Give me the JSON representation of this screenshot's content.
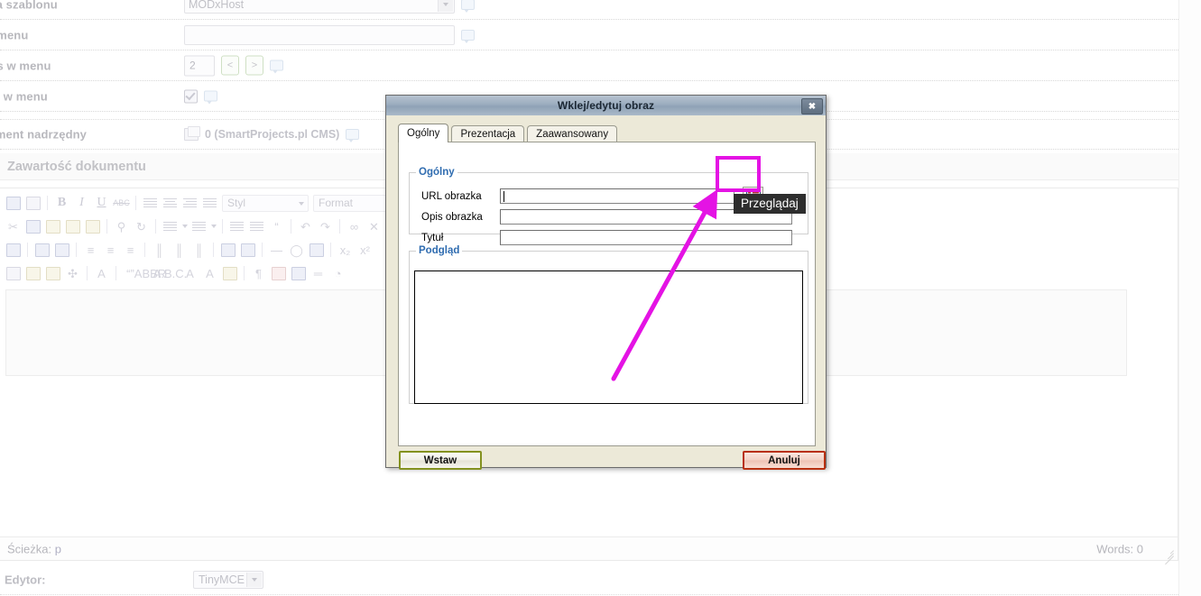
{
  "backend_form": {
    "rows": [
      {
        "label": "Używa szablonu",
        "type": "select",
        "value": "MODxHost",
        "has_help": true
      },
      {
        "label": "Tytuł menu",
        "type": "text",
        "value": "",
        "has_help": true
      },
      {
        "label": "Indeks w menu",
        "type": "number",
        "value": "2",
        "prev_label": "<",
        "next_label": ">",
        "has_help": true
      },
      {
        "label": "Pokaż w menu",
        "type": "checkbox",
        "checked": true,
        "has_help": true
      },
      {
        "label": "Dokument nadrzędny",
        "type": "parent",
        "value": "0 (SmartProjects.pl CMS)",
        "has_help": true
      }
    ]
  },
  "content_section": {
    "title": "Zawartość dokumentu"
  },
  "editor": {
    "toolbar_rows": [
      [
        {
          "icon": "save-icon",
          "kind": "sq-blue"
        },
        {
          "icon": "new-document-icon",
          "kind": "sq"
        },
        {
          "icon": "separator",
          "kind": "sep"
        },
        {
          "icon": "bold-icon",
          "kind": "glyph",
          "glyph": "B",
          "style": "bold"
        },
        {
          "icon": "italic-icon",
          "kind": "glyph",
          "glyph": "I",
          "style": "ital"
        },
        {
          "icon": "underline-icon",
          "kind": "glyph",
          "glyph": "U",
          "style": "undl"
        },
        {
          "icon": "strikethrough-icon",
          "kind": "glyph",
          "glyph": "ABC",
          "style": "strk"
        },
        {
          "icon": "separator",
          "kind": "sep"
        },
        {
          "icon": "align-left-icon",
          "kind": "lines",
          "align": "l"
        },
        {
          "icon": "align-center-icon",
          "kind": "lines",
          "align": "c"
        },
        {
          "icon": "align-right-icon",
          "kind": "lines",
          "align": "r"
        },
        {
          "icon": "align-justify-icon",
          "kind": "lines",
          "align": "j"
        }
      ],
      [
        {
          "icon": "cut-icon",
          "kind": "glyph",
          "glyph": "✂"
        },
        {
          "icon": "copy-icon",
          "kind": "sq-blue"
        },
        {
          "icon": "paste-icon",
          "kind": "sq-yel"
        },
        {
          "icon": "paste-as-text-icon",
          "kind": "sq-yel"
        },
        {
          "icon": "paste-from-word-icon",
          "kind": "sq-yel"
        },
        {
          "icon": "separator",
          "kind": "sep"
        },
        {
          "icon": "search-icon",
          "kind": "glyph",
          "glyph": "⚲"
        },
        {
          "icon": "replace-icon",
          "kind": "glyph",
          "glyph": "↻"
        },
        {
          "icon": "separator",
          "kind": "sep"
        },
        {
          "icon": "bullet-list-icon",
          "kind": "lines",
          "align": "l"
        },
        {
          "icon": "bullet-list-dropdown-icon",
          "kind": "caret"
        },
        {
          "icon": "numbered-list-icon",
          "kind": "lines",
          "align": "l"
        },
        {
          "icon": "numbered-list-dropdown-icon",
          "kind": "caret"
        },
        {
          "icon": "separator",
          "kind": "sep"
        },
        {
          "icon": "outdent-icon",
          "kind": "lines",
          "align": "l"
        },
        {
          "icon": "indent-icon",
          "kind": "lines",
          "align": "l"
        },
        {
          "icon": "blockquote-icon",
          "kind": "glyph",
          "glyph": "“"
        },
        {
          "icon": "separator",
          "kind": "sep"
        },
        {
          "icon": "undo-icon",
          "kind": "glyph",
          "glyph": "↶"
        },
        {
          "icon": "redo-icon",
          "kind": "glyph",
          "glyph": "↷"
        },
        {
          "icon": "separator",
          "kind": "sep"
        },
        {
          "icon": "link-icon",
          "kind": "glyph",
          "glyph": "∞"
        },
        {
          "icon": "unlink-icon",
          "kind": "glyph",
          "glyph": "✕"
        }
      ],
      [
        {
          "icon": "edit-source-icon",
          "kind": "sq-blue"
        },
        {
          "icon": "separator",
          "kind": "sep"
        },
        {
          "icon": "table-row-props-icon",
          "kind": "sq-blue"
        },
        {
          "icon": "table-cell-props-icon",
          "kind": "sq-blue"
        },
        {
          "icon": "separator",
          "kind": "sep"
        },
        {
          "icon": "insert-row-before-icon",
          "kind": "glyph",
          "glyph": "≡"
        },
        {
          "icon": "insert-row-after-icon",
          "kind": "glyph",
          "glyph": "≡"
        },
        {
          "icon": "delete-row-icon",
          "kind": "glyph",
          "glyph": "≡"
        },
        {
          "icon": "separator",
          "kind": "sep"
        },
        {
          "icon": "insert-column-before-icon",
          "kind": "glyph",
          "glyph": "║"
        },
        {
          "icon": "insert-column-after-icon",
          "kind": "glyph",
          "glyph": "║"
        },
        {
          "icon": "delete-column-icon",
          "kind": "glyph",
          "glyph": "║"
        },
        {
          "icon": "separator",
          "kind": "sep"
        },
        {
          "icon": "split-cells-icon",
          "kind": "sq-blue"
        },
        {
          "icon": "merge-cells-icon",
          "kind": "sq-blue"
        },
        {
          "icon": "separator",
          "kind": "sep"
        },
        {
          "icon": "horizontal-rule-icon",
          "kind": "glyph",
          "glyph": "—"
        },
        {
          "icon": "remove-format-icon",
          "kind": "glyph",
          "glyph": "◯"
        },
        {
          "icon": "table-icon",
          "kind": "sq-blue"
        },
        {
          "icon": "separator",
          "kind": "sep"
        },
        {
          "icon": "subscript-icon",
          "kind": "glyph",
          "glyph": "x₂"
        },
        {
          "icon": "superscript-icon",
          "kind": "glyph",
          "glyph": "x²"
        }
      ],
      [
        {
          "icon": "select-area-icon",
          "kind": "sq"
        },
        {
          "icon": "layer-icon",
          "kind": "sq-yel"
        },
        {
          "icon": "layer-back-icon",
          "kind": "sq-yel"
        },
        {
          "icon": "move-layer-icon",
          "kind": "glyph",
          "glyph": "✣"
        },
        {
          "icon": "separator",
          "kind": "sep"
        },
        {
          "icon": "styles-icon",
          "kind": "glyph",
          "glyph": "A"
        },
        {
          "icon": "separator",
          "kind": "sep"
        },
        {
          "icon": "citation-icon",
          "kind": "glyph",
          "glyph": "“”"
        },
        {
          "icon": "abbreviation-icon",
          "kind": "glyph",
          "glyph": "ABBR"
        },
        {
          "icon": "acronym-icon",
          "kind": "glyph",
          "glyph": "A.B.C."
        },
        {
          "icon": "delete-text-icon",
          "kind": "glyph",
          "glyph": "A"
        },
        {
          "icon": "insert-text-icon",
          "kind": "glyph",
          "glyph": "A"
        },
        {
          "icon": "attributes-icon",
          "kind": "sq-yel"
        },
        {
          "icon": "separator",
          "kind": "sep"
        },
        {
          "icon": "show-invisible-icon",
          "kind": "glyph",
          "glyph": "¶"
        },
        {
          "icon": "toggle-guides-icon",
          "kind": "sq-red"
        },
        {
          "icon": "template-icon",
          "kind": "sq-blue"
        },
        {
          "icon": "page-break-icon",
          "kind": "glyph",
          "glyph": "═"
        },
        {
          "icon": "media-icon",
          "kind": "glyph",
          "glyph": "◔"
        }
      ]
    ],
    "style_select": "Styl",
    "format_select": "Format",
    "path_label": "Ścieżka:",
    "path_value": "p",
    "words_label": "Words: 0"
  },
  "editor_selector": {
    "label": "Edytor:",
    "value": "TinyMCE"
  },
  "dialog": {
    "title": "Wklej/edytuj obraz",
    "close_label": "✖",
    "tabs": [
      {
        "label": "Ogólny",
        "active": true
      },
      {
        "label": "Prezentacja",
        "active": false
      },
      {
        "label": "Zaawansowany",
        "active": false
      }
    ],
    "general_group": {
      "legend": "Ogólny",
      "fields": [
        {
          "label": "URL obrazka",
          "value": "",
          "has_browse": true
        },
        {
          "label": "Opis obrazka",
          "value": "",
          "has_browse": false
        },
        {
          "label": "Tytuł",
          "value": "",
          "has_browse": false
        }
      ]
    },
    "preview_group": {
      "legend": "Podgląd"
    },
    "buttons": {
      "insert": "Wstaw",
      "cancel": "Anuluj"
    },
    "tooltip": "Przeglądaj"
  },
  "annotation": {
    "highlight_color": "#e413e4",
    "arrow_color": "#e413e4"
  }
}
